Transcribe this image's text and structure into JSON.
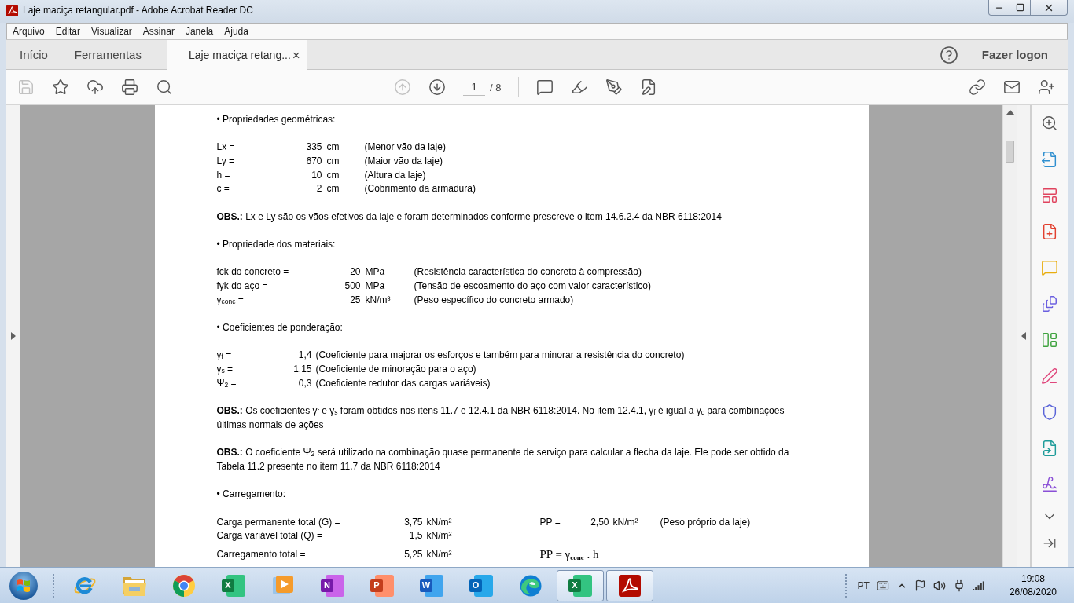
{
  "window": {
    "title": "Laje maciça retangular.pdf - Adobe Acrobat Reader DC"
  },
  "menu": [
    "Arquivo",
    "Editar",
    "Visualizar",
    "Assinar",
    "Janela",
    "Ajuda"
  ],
  "tabs": [
    {
      "label": "Início",
      "selected": false
    },
    {
      "label": "Ferramentas",
      "selected": false
    },
    {
      "label": "Laje maciça retang...",
      "selected": true,
      "close": "×"
    }
  ],
  "account": {
    "sign_in": "Fazer logon"
  },
  "toolbar": {
    "tools": [
      {
        "kind": "save",
        "disabled": true
      },
      {
        "kind": "bookmark",
        "disabled": false
      },
      {
        "kind": "upload",
        "disabled": false
      },
      {
        "kind": "print",
        "disabled": false
      },
      {
        "kind": "find",
        "disabled": false
      }
    ],
    "navigation": [
      {
        "kind": "previous",
        "disabled": true
      },
      {
        "kind": "next",
        "disabled": false
      }
    ],
    "page": {
      "value": "1",
      "total": "/ 8"
    }
  },
  "document": {
    "blocks": [
      {
        "kind": "heading",
        "text": "• Propriedades geométricas:"
      },
      {
        "kind": "quantities",
        "rows": [
          {
            "label": "Lx =",
            "value": "335",
            "unit": "cm",
            "description": "(Menor vão da laje)"
          },
          {
            "label": "Ly =",
            "value": "670",
            "unit": "cm",
            "description": "(Maior vão da laje)"
          },
          {
            "label": "h =",
            "value": "10",
            "unit": "cm",
            "description": "(Altura da laje)"
          },
          {
            "label": "c =",
            "value": "2",
            "unit": "cm",
            "description": "(Cobrimento da armadura)"
          }
        ]
      },
      {
        "kind": "note",
        "text": "**OBS.:** Lx e Ly são os vãos efetivos da laje e foram determinados conforme prescreve o item 14.6.2.4 da NBR 6118:2014"
      },
      {
        "kind": "heading",
        "text": "• Propriedade dos materiais:"
      },
      {
        "kind": "quantities",
        "rows": [
          {
            "label": "fck do concreto =",
            "value": "20",
            "unit": "MPa",
            "description": "(Resistência característica do concreto à compressão)"
          },
          {
            "label": "fyk do aço =",
            "value": "500",
            "unit": "MPa",
            "description": "(Tensão de escoamento do aço com valor característico)"
          },
          {
            "label": "γ$_{conc}$ =",
            "value": "25",
            "unit": "kN/m³",
            "description": "(Peso específico do concreto armado)"
          }
        ]
      },
      {
        "kind": "heading",
        "text": "• Coeficientes de ponderação:"
      },
      {
        "kind": "coefficients",
        "rows": [
          {
            "label": "γ$_{f}$ =",
            "value": "1,4",
            "description": "(Coeficiente para majorar os esforços e também para minorar a resistência do concreto)"
          },
          {
            "label": "γ$_{s}$ =",
            "value": "1,15",
            "description": "(Coeficiente de minoração para o aço)"
          },
          {
            "label": "Ψ$_{2}$ =",
            "value": "0,3",
            "description": "(Coeficiente redutor das cargas variáveis)"
          }
        ]
      },
      {
        "kind": "note",
        "text": "**OBS.:** Os coeficientes γ$_{f}$ e γ$_{s}$ foram obtidos nos itens 11.7 e 12.4.1 da NBR 6118:2014. No item 12.4.1, γ$_{f}$ é igual a γ$_{c}$ para combinações últimas normais de ações"
      },
      {
        "kind": "note",
        "text": "**OBS.:** O coeficiente Ψ$_{2}$ será utilizado na combinação quase permanente de serviço para calcular a flecha da laje. Ele pode ser obtido da Tabela 11.2 presente no item 11.7 da NBR 6118:2014"
      },
      {
        "kind": "heading",
        "text": "• Carregamento:"
      },
      {
        "kind": "loads",
        "rows": [
          {
            "label": "Carga permanente total (G) =",
            "value": "3,75",
            "unit": "kN/m²"
          },
          {
            "label": "Carga variável total (Q) =",
            "value": "1,5",
            "unit": "kN/m²"
          },
          {
            "label": "Carregamento total =",
            "value": "5,25",
            "unit": "kN/m²"
          }
        ],
        "side": {
          "label": "PP =",
          "value": "2,50",
          "unit": "kN/m²",
          "description": "(Peso próprio da laje)",
          "formula": "PP = γ$_{conc}$ . h"
        }
      }
    ]
  },
  "taskbar": {
    "apps": [
      {
        "kind": "ie",
        "open": false
      },
      {
        "kind": "explorer",
        "open": false
      },
      {
        "kind": "chrome",
        "open": false
      },
      {
        "kind": "excel",
        "glyph": "X",
        "open": false
      },
      {
        "kind": "media",
        "open": false
      },
      {
        "kind": "onenote",
        "glyph": "N",
        "open": false
      },
      {
        "kind": "powerpoint",
        "glyph": "P",
        "open": false
      },
      {
        "kind": "word",
        "glyph": "W",
        "open": false
      },
      {
        "kind": "outlook",
        "glyph": "O",
        "open": false
      },
      {
        "kind": "edge",
        "open": false
      },
      {
        "kind": "excel",
        "glyph": "X",
        "open": true
      },
      {
        "kind": "acrobat",
        "open": true
      }
    ],
    "language": "PT",
    "time": "19:08",
    "date": "26/08/2020"
  }
}
